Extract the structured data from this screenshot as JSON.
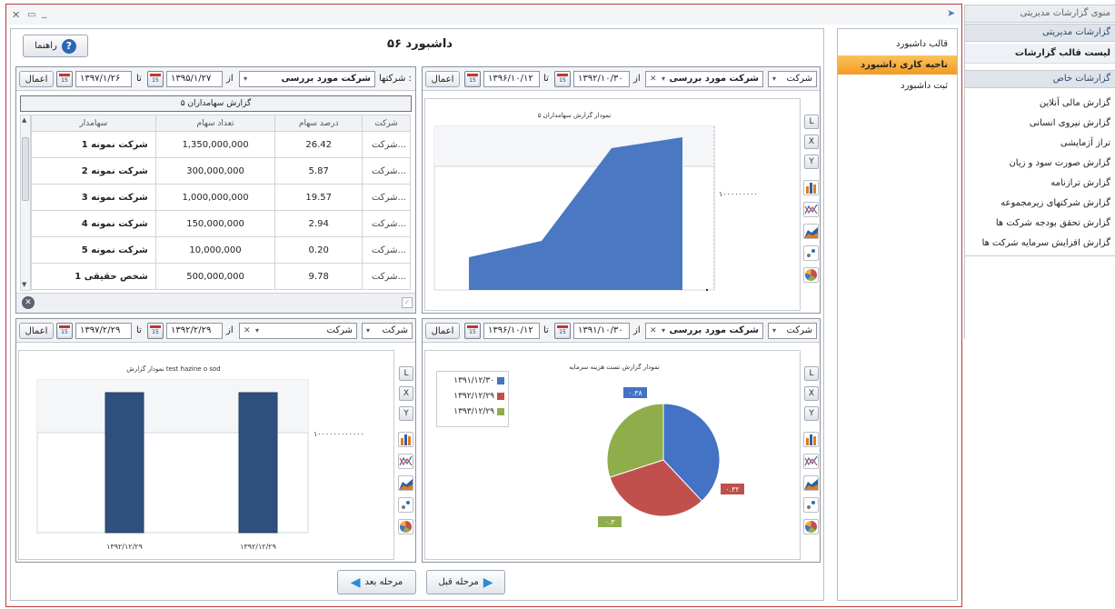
{
  "window": {
    "title": "داشبورد ۵۶",
    "help_label": "راهنما",
    "prev_label": "مرحله قبل",
    "next_label": "مرحله بعد"
  },
  "panels": {
    "top_left": {
      "shareholders_label": "شرکتها :",
      "shareholders_value": "شرکت مورد بررسی",
      "from_label": "از",
      "from_date": "۱۳۹۵/۱/۲۷",
      "to_label": "تا",
      "to_date": "۱۳۹۷/۱/۲۶",
      "apply_label": "اعمال",
      "report_title": "گزارش سهامداران ۵",
      "columns": [
        "شرکت",
        "درصد سهام",
        "تعداد سهام",
        "سهامدار"
      ],
      "rows": [
        {
          "company": "شرکت...",
          "percent": "26.42",
          "count": "1,350,000,000",
          "holder": "شرکت نمونه 1"
        },
        {
          "company": "شرکت...",
          "percent": "5.87",
          "count": "300,000,000",
          "holder": "شرکت نمونه 2"
        },
        {
          "company": "شرکت...",
          "percent": "19.57",
          "count": "1,000,000,000",
          "holder": "شرکت نمونه 3"
        },
        {
          "company": "شرکت...",
          "percent": "2.94",
          "count": "150,000,000",
          "holder": "شرکت نمونه 4"
        },
        {
          "company": "شرکت...",
          "percent": "0.20",
          "count": "10,000,000",
          "holder": "شرکت نمونه 5"
        },
        {
          "company": "شرکت...",
          "percent": "9.78",
          "count": "500,000,000",
          "holder": "شخص حقیقی 1"
        }
      ]
    },
    "top_right": {
      "company_label": "شرکت",
      "company_value": "شرکت مورد بررسی",
      "from_label": "از",
      "from_date": "۱۳۹۲/۱۰/۳۰",
      "to_label": "تا",
      "to_date": "۱۳۹۶/۱۰/۱۲",
      "apply_label": "اعمال"
    },
    "bottom_left": {
      "company_label": "شرکت",
      "company_value": "شرکت",
      "from_label": "از",
      "from_date": "۱۳۹۲/۲/۲۹",
      "to_label": "تا",
      "to_date": "۱۳۹۷/۲/۲۹",
      "apply_label": "اعمال"
    },
    "bottom_right": {
      "company_label": "شرکت",
      "company_value": "شرکت مورد بررسی",
      "from_label": "از",
      "from_date": "۱۳۹۱/۱۰/۳۰",
      "to_label": "تا",
      "to_date": "۱۳۹۶/۱۰/۱۲",
      "apply_label": "اعمال"
    }
  },
  "chart_side_buttons": [
    "L",
    "X",
    "Y"
  ],
  "chart_data": [
    {
      "type": "area",
      "title": "نمودار گزارش سهامداران ۵",
      "x": [
        1,
        2,
        3,
        4
      ],
      "values": [
        0.6,
        0.9,
        2.6,
        2.8
      ],
      "y_tick_label": "۱۰۰۰۰۰۰۰۰۰",
      "grid": true,
      "color": "#4a78c2"
    },
    {
      "type": "bar",
      "title": "نمودار گزارش test hazine o sod",
      "categories": [
        "۱۳۹۲/۱۲/۲۹",
        "۱۳۹۲/۱۲/۲۹"
      ],
      "values": [
        1,
        1
      ],
      "y_tick_label": "۱۰۰۰۰۰۰۰۰۰۰۰۰",
      "grid": true,
      "color": "#2f4f7f"
    },
    {
      "type": "pie",
      "title": "نمودار گزارش تست هزینه سرمایه",
      "legend": [
        "۱۳۹۱/۱۲/۳۰",
        "۱۳۹۲/۱۲/۲۹",
        "۱۳۹۳/۱۲/۲۹"
      ],
      "values": [
        0.38,
        0.32,
        0.3
      ],
      "labels": [
        "۰.۳۸",
        "۰.۳۲",
        "۰.۳"
      ],
      "colors": [
        "#4472c4",
        "#c0504d",
        "#8fad4b"
      ],
      "legend_position": "top-left"
    }
  ],
  "dashboard_list": {
    "items": [
      "قالب داشبورد",
      "ناحیه کاری داشبورد",
      "ثبت داشبورد"
    ],
    "selected_index": 1,
    "selected_color": "#f7a934"
  },
  "menu": {
    "title": "منوی گزارشات مدیریتی",
    "section1": "گزارشات مدیریتی",
    "item_template_list": "لیست قالب گزارشات",
    "section2": "گزارشات خاص",
    "items": [
      "گزارش مالی آنلاین",
      "گزارش نیروی انسانی",
      "تراز آزمایشی",
      "گزارش صورت سود و زیان",
      "گزارش ترازنامه",
      "گزارش شرکتهای زیرمجموعه",
      "گزارش تحقق بودجه شرکت ها",
      "گزارش افزایش سرمایه شرکت ها"
    ]
  }
}
